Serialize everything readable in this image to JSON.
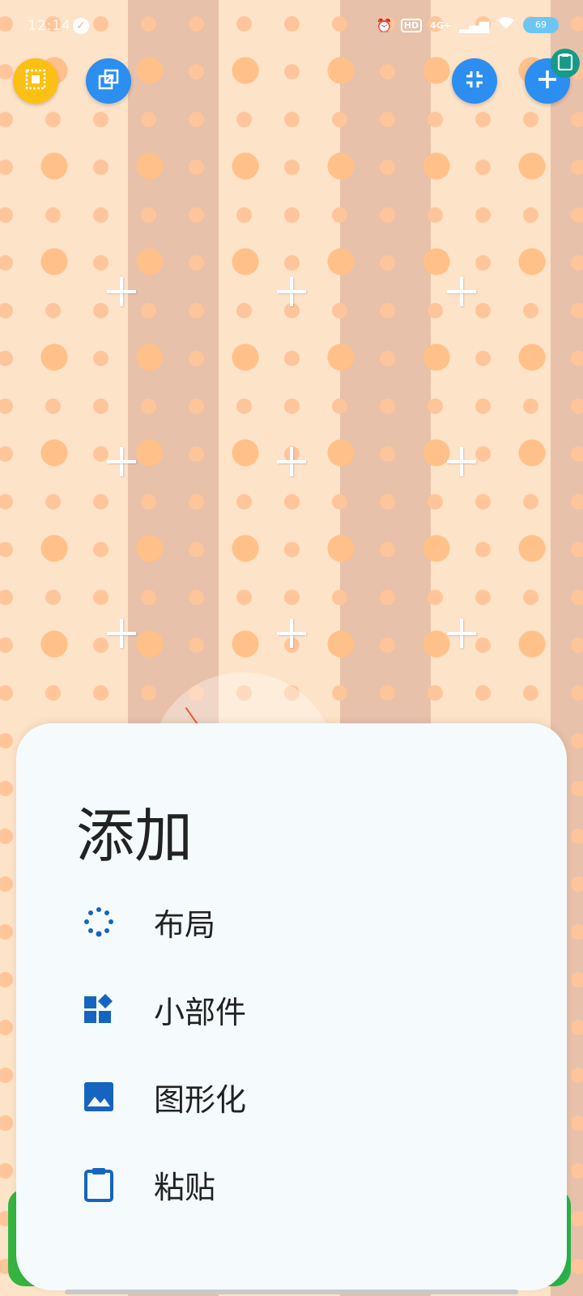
{
  "status_bar": {
    "time": "12:14",
    "network": "4G+",
    "hd": "HD",
    "battery": "69"
  },
  "top_buttons": {
    "left1_icon": "select-area-icon",
    "left2_icon": "resize-icon",
    "right1_icon": "collapse-icon",
    "right2_icon": "add-icon",
    "badge_icon": "clipboard-icon"
  },
  "sheet": {
    "title": "添加",
    "items": [
      {
        "label": "布局",
        "icon": "layout-dots-icon"
      },
      {
        "label": "小部件",
        "icon": "widget-icon"
      },
      {
        "label": "图形化",
        "icon": "image-icon"
      },
      {
        "label": "粘贴",
        "icon": "clipboard-icon"
      }
    ]
  },
  "colors": {
    "accent": "#1565c0",
    "fab_blue": "#2b8ef0",
    "fab_yellow": "#fcc014",
    "sheet_bg": "#f5fbfd"
  }
}
